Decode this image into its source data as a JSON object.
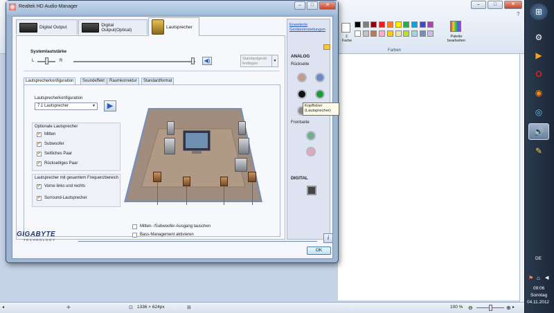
{
  "paint": {
    "color_label": "2.\nFarbe",
    "colors_group": "Farben",
    "palette_label": "Palette\nbearbeiten",
    "swatches_row1": [
      "#000000",
      "#7f7f7f",
      "#880015",
      "#ed1c24",
      "#ff7f27",
      "#fff200",
      "#22b14c",
      "#00a2e8",
      "#3f48cc",
      "#a349a4"
    ],
    "swatches_row2": [
      "#ffffff",
      "#c3c3c3",
      "#b97a57",
      "#ffaec9",
      "#ffc90e",
      "#efe4b0",
      "#b5e61d",
      "#99d9ea",
      "#7092be",
      "#c8bfe7"
    ],
    "status_size": "1336 × 624px",
    "zoom": "100 %"
  },
  "taskbar": {
    "lang": "DE",
    "time": "09:06",
    "day": "Sonntag",
    "date": "04.11.2012",
    "icons": [
      "windows-start-icon",
      "steam-icon",
      "media-player-icon",
      "opera-icon",
      "firefox-icon",
      "clock-icon",
      "realtek-speaker-icon",
      "paint-icon"
    ]
  },
  "window": {
    "title": "Realtek HD Audio-Manager",
    "tabs": [
      "Digital Output",
      "Digital Output(Optical)",
      "Lautsprecher"
    ],
    "volume_label": "Systemlautstärke",
    "left": "L",
    "right": "R",
    "default_device": "Standardgerät\nfestlegen",
    "subtabs": [
      "Lautsprecherkonfiguration",
      "Soundeffekt",
      "Raumkorrektur",
      "Standardformat"
    ],
    "config_label": "Lautsprecherkonfiguration",
    "config_value": "7.1 Lautsprecher",
    "optional_group": "Optionale Lautsprecher",
    "optional_items": [
      "Mitten",
      "Subwoofer",
      "Seitliches Paar",
      "Rückseitiges Paar"
    ],
    "fullrange_group": "Lautsprecher mit gesamtem Frequenzbereich",
    "fullrange_items": [
      "Vorne links und rechts",
      "Surround-Lautsprecher"
    ],
    "swap_option": "Mitten- /Subwoofer-Ausgang tauschen",
    "bass_option": "Bass-Management aktivieren",
    "advanced_link": "Erweiterte\nGeräteeinstellungen",
    "analog": "ANALOG",
    "rear": "Rückseite",
    "front": "Frontseite",
    "digital": "DIGITAL",
    "tooltip": "Kopfhörer\n(Lautsprecher)",
    "brand": "GIGABYTE",
    "brand_sub": "TECHNOLOGY",
    "ok": "OK"
  }
}
